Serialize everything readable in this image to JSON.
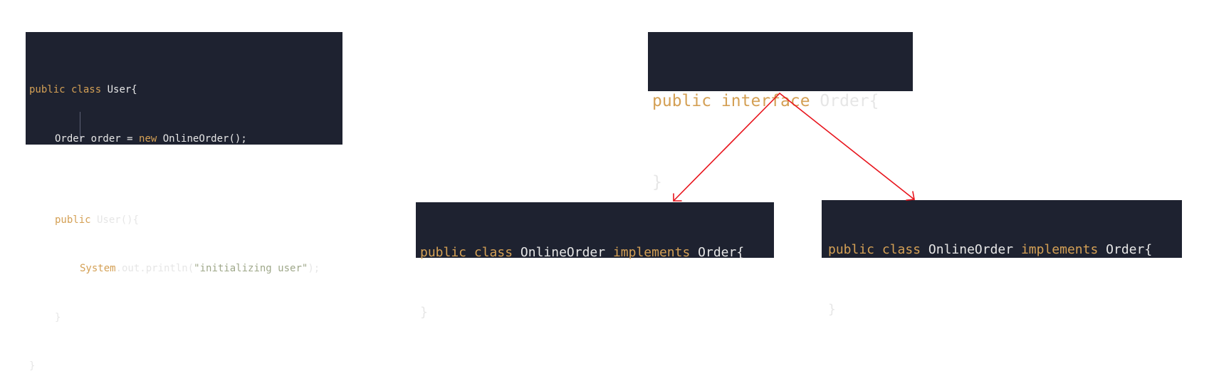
{
  "user_class": {
    "line1": {
      "kw": "public class",
      "name": "User{"
    },
    "line2": {
      "type": "Order order = ",
      "kw": "new",
      "rest": " OnlineOrder();"
    },
    "line3": "",
    "line4": {
      "kw": "public",
      "rest": " User(){"
    },
    "line5": {
      "sys": "System",
      "rest": ".out.println(",
      "str": "\"initializing user\"",
      "end": ");"
    },
    "line6": "}",
    "line7": "}"
  },
  "order_interface": {
    "kw": "public interface",
    "name": "Order{",
    "close": "}"
  },
  "online_order_left": {
    "kw1": "public class",
    "name": "OnlineOrder",
    "kw2": "implements",
    "iface": "Order{",
    "close": "}"
  },
  "online_order_right": {
    "kw1": "public class",
    "name": "OnlineOrder",
    "kw2": "implements",
    "iface": "Order{",
    "close": "}"
  },
  "colors": {
    "code_bg": "#1e2230",
    "keyword": "#d4a055",
    "identifier": "#e6e6e6",
    "string": "#9fa88a",
    "arrow": "#e8141c"
  }
}
